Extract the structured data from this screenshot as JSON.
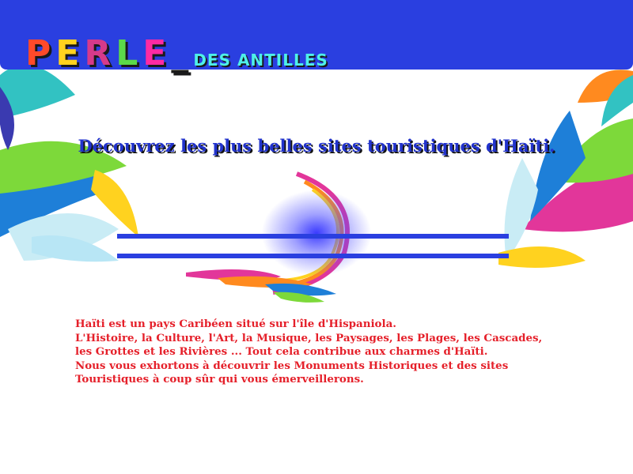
{
  "header": {
    "logo_main": "PERLE_",
    "logo_sub": "DES ANTILLES"
  },
  "hero": {
    "headline": "Découvrez les plus belles sites touristiques d'Haïti."
  },
  "intro": {
    "lines": [
      "Haïti est un pays Caribéen situé sur l'île d'Hispaniola.",
      "L'Histoire, la Culture, l'Art, la Musique, les Paysages, les Plages, les Cascades,",
      "les Grottes et les Rivières ... Tout cela contribue aux charmes d'Haïti.",
      "Nous vous exhortons à découvrir les Monuments Historiques et des sites",
      "Touristiques à coup sûr qui vous émerveillerons."
    ]
  },
  "colors": {
    "primary_blue": "#2a3fe0",
    "text_red": "#e5202a",
    "logo_cyan": "#4ef0e8"
  }
}
